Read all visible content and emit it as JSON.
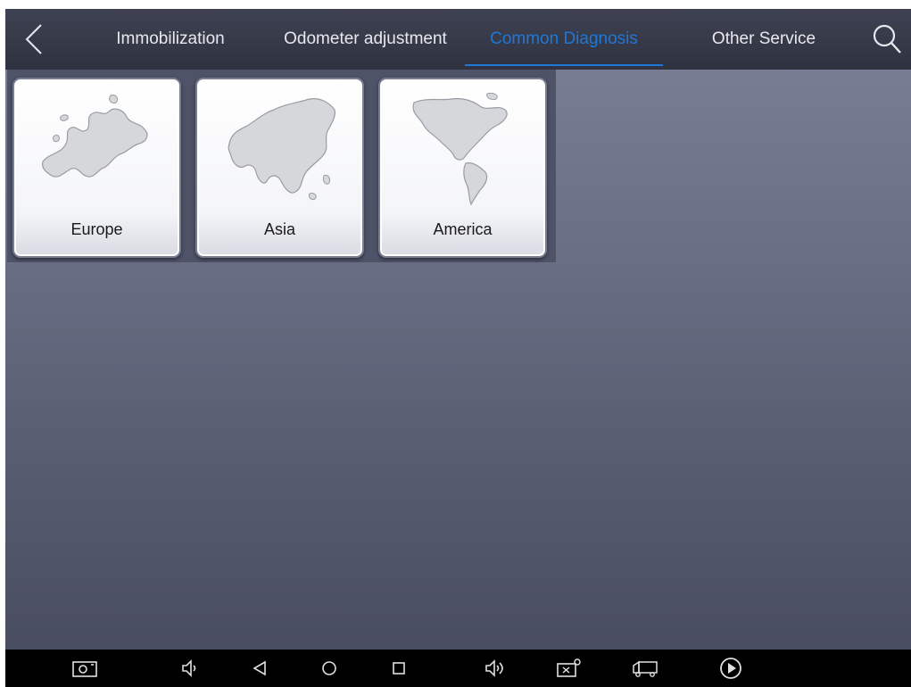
{
  "topbar": {
    "back_icon": "chevron-left-icon",
    "tabs": [
      {
        "label": "Immobilization",
        "active": false
      },
      {
        "label": "Odometer adjustment",
        "active": false
      },
      {
        "label": "Common Diagnosis",
        "active": true
      },
      {
        "label": "Other Service",
        "active": false
      }
    ],
    "search_icon": "search-icon",
    "active_color": "#1e78d8"
  },
  "regions": [
    {
      "label": "Europe",
      "icon": "europe-map-icon"
    },
    {
      "label": "Asia",
      "icon": "asia-map-icon"
    },
    {
      "label": "America",
      "icon": "america-map-icon"
    }
  ],
  "navbar": {
    "icons": [
      "screenshot-icon",
      "volume-down-icon",
      "back-triangle-icon",
      "home-circle-icon",
      "recents-square-icon",
      "volume-up-icon",
      "vci-connection-icon",
      "truck-icon",
      "play-icon"
    ]
  }
}
